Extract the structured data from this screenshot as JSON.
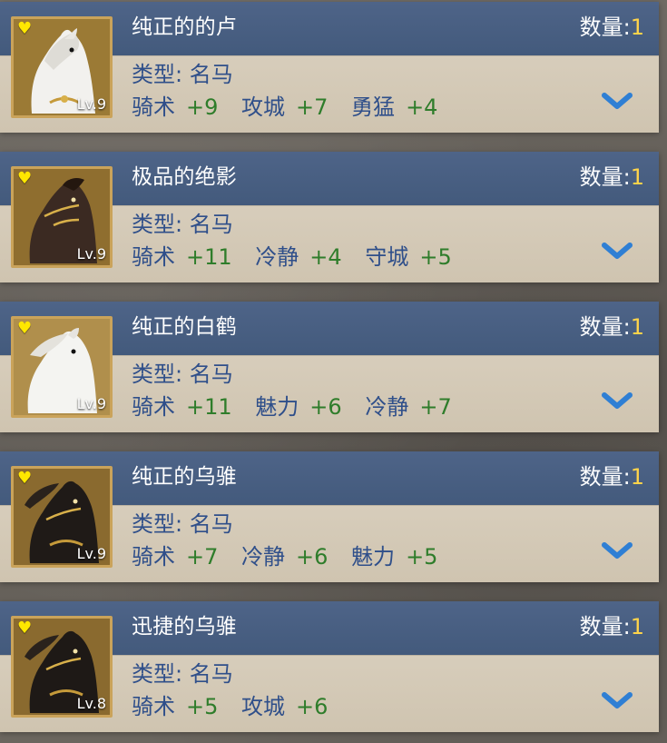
{
  "qty_label": "数量:",
  "type_label": "类型:",
  "colors": {
    "header": "#435a7c",
    "body": "#d1c6b2",
    "stat_name": "#2f4f8a",
    "stat_value": "#2f7d2b",
    "qty_value": "#ffd44a",
    "heart": "#ffe700"
  },
  "items": [
    {
      "name": "纯正的的卢",
      "quantity": "1",
      "type": "名马",
      "level": "Lv.9",
      "horse_color": "white",
      "favorite_icon": "heart-icon",
      "expand_icon": "chevron-down-icon",
      "stats": [
        {
          "name": "骑术",
          "value": "+9"
        },
        {
          "name": "攻城",
          "value": "+7"
        },
        {
          "name": "勇猛",
          "value": "+4"
        }
      ]
    },
    {
      "name": "极品的绝影",
      "quantity": "1",
      "type": "名马",
      "level": "Lv.9",
      "horse_color": "dark-brown",
      "favorite_icon": "heart-icon",
      "expand_icon": "chevron-down-icon",
      "stats": [
        {
          "name": "骑术",
          "value": "+11"
        },
        {
          "name": "冷静",
          "value": "+4"
        },
        {
          "name": "守城",
          "value": "+5"
        }
      ]
    },
    {
      "name": "纯正的白鹤",
      "quantity": "1",
      "type": "名马",
      "level": "Lv.9",
      "horse_color": "white",
      "favorite_icon": "heart-icon",
      "expand_icon": "chevron-down-icon",
      "stats": [
        {
          "name": "骑术",
          "value": "+11"
        },
        {
          "name": "魅力",
          "value": "+6"
        },
        {
          "name": "冷静",
          "value": "+7"
        }
      ]
    },
    {
      "name": "纯正的乌骓",
      "quantity": "1",
      "type": "名马",
      "level": "Lv.9",
      "horse_color": "black",
      "favorite_icon": "heart-icon",
      "expand_icon": "chevron-down-icon",
      "stats": [
        {
          "name": "骑术",
          "value": "+7"
        },
        {
          "name": "冷静",
          "value": "+6"
        },
        {
          "name": "魅力",
          "value": "+5"
        }
      ]
    },
    {
      "name": "迅捷的乌骓",
      "quantity": "1",
      "type": "名马",
      "level": "Lv.8",
      "horse_color": "black",
      "favorite_icon": "heart-icon",
      "expand_icon": "chevron-down-icon",
      "stats": [
        {
          "name": "骑术",
          "value": "+5"
        },
        {
          "name": "攻城",
          "value": "+6"
        }
      ]
    }
  ]
}
